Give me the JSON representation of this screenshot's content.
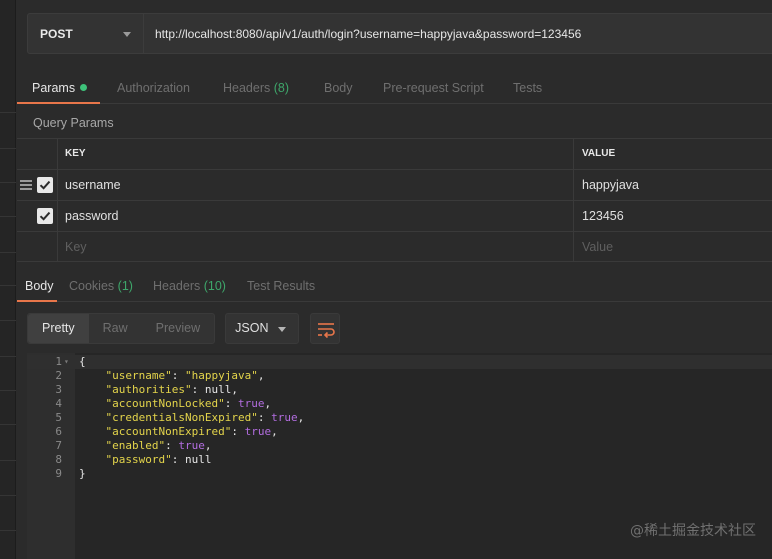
{
  "request": {
    "method": "POST",
    "url": "http://localhost:8080/api/v1/auth/login?username=happyjava&password=123456"
  },
  "request_tabs": [
    {
      "label": "Params",
      "count": "",
      "active": true,
      "has_dot": true
    },
    {
      "label": "Authorization",
      "count": "",
      "active": false
    },
    {
      "label": "Headers",
      "count": "(8)",
      "active": false
    },
    {
      "label": "Body",
      "count": "",
      "active": false
    },
    {
      "label": "Pre-request Script",
      "count": "",
      "active": false
    },
    {
      "label": "Tests",
      "count": "",
      "active": false
    }
  ],
  "query_params_label": "Query Params",
  "params_table": {
    "headers": {
      "key": "KEY",
      "value": "VALUE"
    },
    "rows": [
      {
        "key": "username",
        "value": "happyjava",
        "checked": true
      },
      {
        "key": "password",
        "value": "123456",
        "checked": true
      }
    ],
    "placeholder": {
      "key": "Key",
      "value": "Value"
    }
  },
  "response_tabs": [
    {
      "label": "Body",
      "count": "",
      "active": true
    },
    {
      "label": "Cookies",
      "count": "(1)",
      "active": false
    },
    {
      "label": "Headers",
      "count": "(10)",
      "active": false
    },
    {
      "label": "Test Results",
      "count": "",
      "active": false
    }
  ],
  "response_toolbar": {
    "formats": [
      "Pretty",
      "Raw",
      "Preview"
    ],
    "active_format": "Pretty",
    "language": "JSON",
    "wrap_icon": "wrap-lines-icon"
  },
  "response_body": {
    "line_numbers": [
      "1",
      "2",
      "3",
      "4",
      "5",
      "6",
      "7",
      "8",
      "9"
    ],
    "open_brace": "{",
    "close_brace": "}",
    "fields": [
      {
        "key": "\"username\"",
        "value": "\"happyjava\"",
        "kind": "string",
        "comma": ","
      },
      {
        "key": "\"authorities\"",
        "value": "null",
        "kind": "null",
        "comma": ","
      },
      {
        "key": "\"accountNonLocked\"",
        "value": "true",
        "kind": "bool",
        "comma": ","
      },
      {
        "key": "\"credentialsNonExpired\"",
        "value": "true",
        "kind": "bool",
        "comma": ","
      },
      {
        "key": "\"accountNonExpired\"",
        "value": "true",
        "kind": "bool",
        "comma": ","
      },
      {
        "key": "\"enabled\"",
        "value": "true",
        "kind": "bool",
        "comma": ","
      },
      {
        "key": "\"password\"",
        "value": "null",
        "kind": "null",
        "comma": ""
      }
    ]
  },
  "watermark": "@稀土掘金技术社区",
  "colors": {
    "accent_underline": "#e8764a",
    "count_green": "#3ea66a",
    "json_key": "#e3d44b",
    "json_bool": "#b36de0"
  }
}
